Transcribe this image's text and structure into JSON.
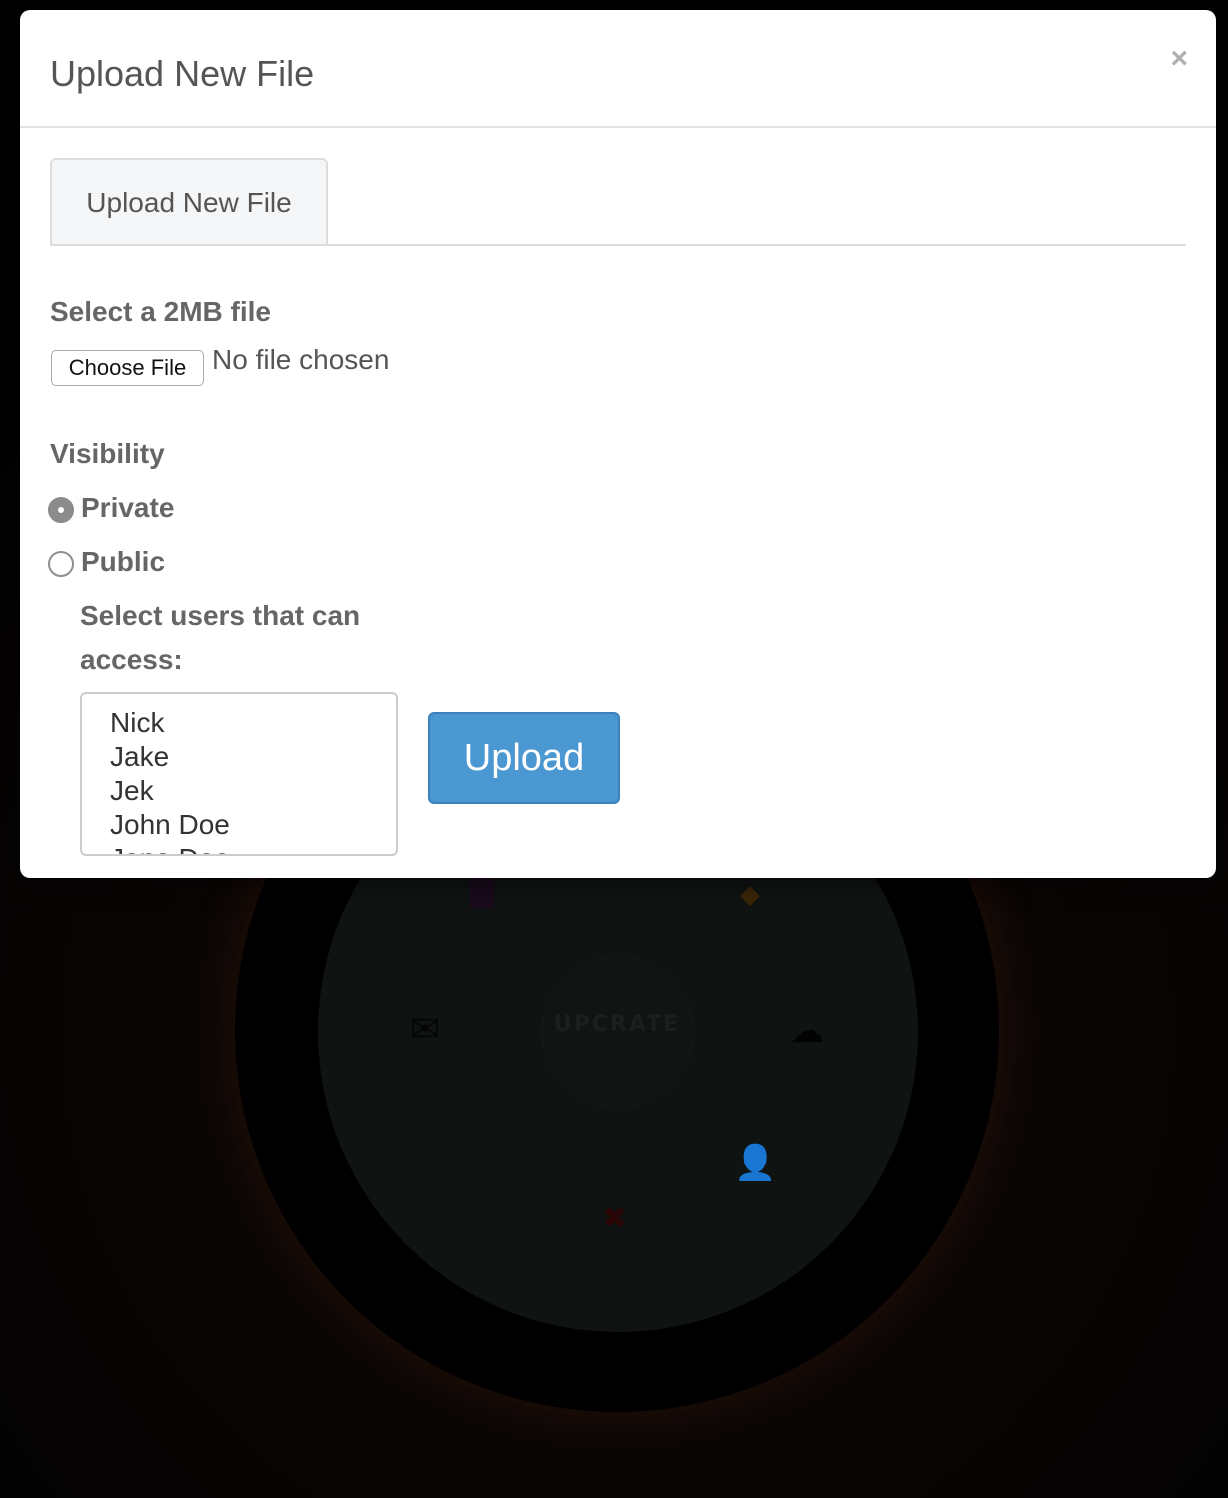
{
  "modal": {
    "title": "Upload New File",
    "close_label": "×"
  },
  "tabs": [
    {
      "label": "Upload New File",
      "active": true
    }
  ],
  "file_input": {
    "label": "Select a 2MB file",
    "button_label": "Choose File",
    "status": "No file chosen"
  },
  "visibility": {
    "label": "Visibility",
    "options": [
      {
        "label": "Private",
        "checked": true
      },
      {
        "label": "Public",
        "checked": false
      }
    ]
  },
  "users": {
    "label_line1": "Select users that can",
    "label_line2": "access:",
    "options": [
      "Nick",
      "Jake",
      "Jek",
      "John Doe",
      "Jane Doe"
    ]
  },
  "upload_button": {
    "label": "Upload"
  },
  "background": {
    "logo_text": "UPCRATE",
    "icons": [
      "document-icon",
      "diamond-icon",
      "mail-icon",
      "cloud-upload-icon",
      "user-icon",
      "close-x-icon"
    ]
  }
}
